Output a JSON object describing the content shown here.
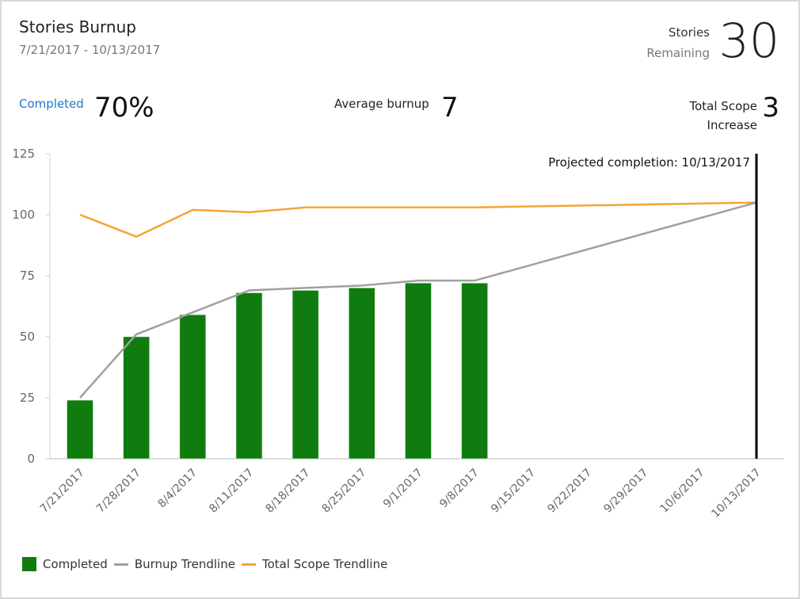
{
  "header": {
    "title": "Stories Burnup",
    "date_range": "7/21/2017 - 10/13/2017",
    "remaining_label_1": "Stories",
    "remaining_label_2": "Remaining",
    "remaining_value": "30"
  },
  "metrics": {
    "completed_label": "Completed",
    "completed_value": "70%",
    "average_label": "Average burnup",
    "average_value": "7",
    "scope_label_1": "Total Scope",
    "scope_label_2": "Increase",
    "scope_value": "3"
  },
  "colors": {
    "completed": "#107c10",
    "burnup": "#a0a0a0",
    "scope": "#f7a435",
    "projection": "#000000",
    "accent": "#1e78c8"
  },
  "chart_data": {
    "type": "bar",
    "title": "Stories Burnup",
    "categories": [
      "7/21/2017",
      "7/28/2017",
      "8/4/2017",
      "8/11/2017",
      "8/18/2017",
      "8/25/2017",
      "9/1/2017",
      "9/8/2017",
      "9/15/2017",
      "9/22/2017",
      "9/29/2017",
      "10/6/2017",
      "10/13/2017"
    ],
    "series": [
      {
        "name": "Completed",
        "type": "bar",
        "values": [
          24,
          50,
          59,
          68,
          69,
          70,
          72,
          72,
          null,
          null,
          null,
          null,
          null
        ]
      },
      {
        "name": "Burnup Trendline",
        "type": "line",
        "values": [
          25,
          51,
          60,
          69,
          70,
          71,
          73,
          73,
          null,
          null,
          null,
          null,
          105
        ]
      },
      {
        "name": "Total Scope Trendline",
        "type": "line",
        "values": [
          100,
          91,
          102,
          101,
          103,
          103,
          103,
          103,
          null,
          null,
          null,
          null,
          105
        ]
      }
    ],
    "yticks": [
      0,
      25,
      50,
      75,
      100,
      125
    ],
    "ylim": [
      0,
      125
    ],
    "xlabel": "",
    "ylabel": "",
    "annotation": "Projected completion: 10/13/2017",
    "projection_category": "10/13/2017",
    "legend": [
      "Completed",
      "Burnup Trendline",
      "Total Scope Trendline"
    ],
    "legend_position": "bottom-left",
    "grid": false
  }
}
